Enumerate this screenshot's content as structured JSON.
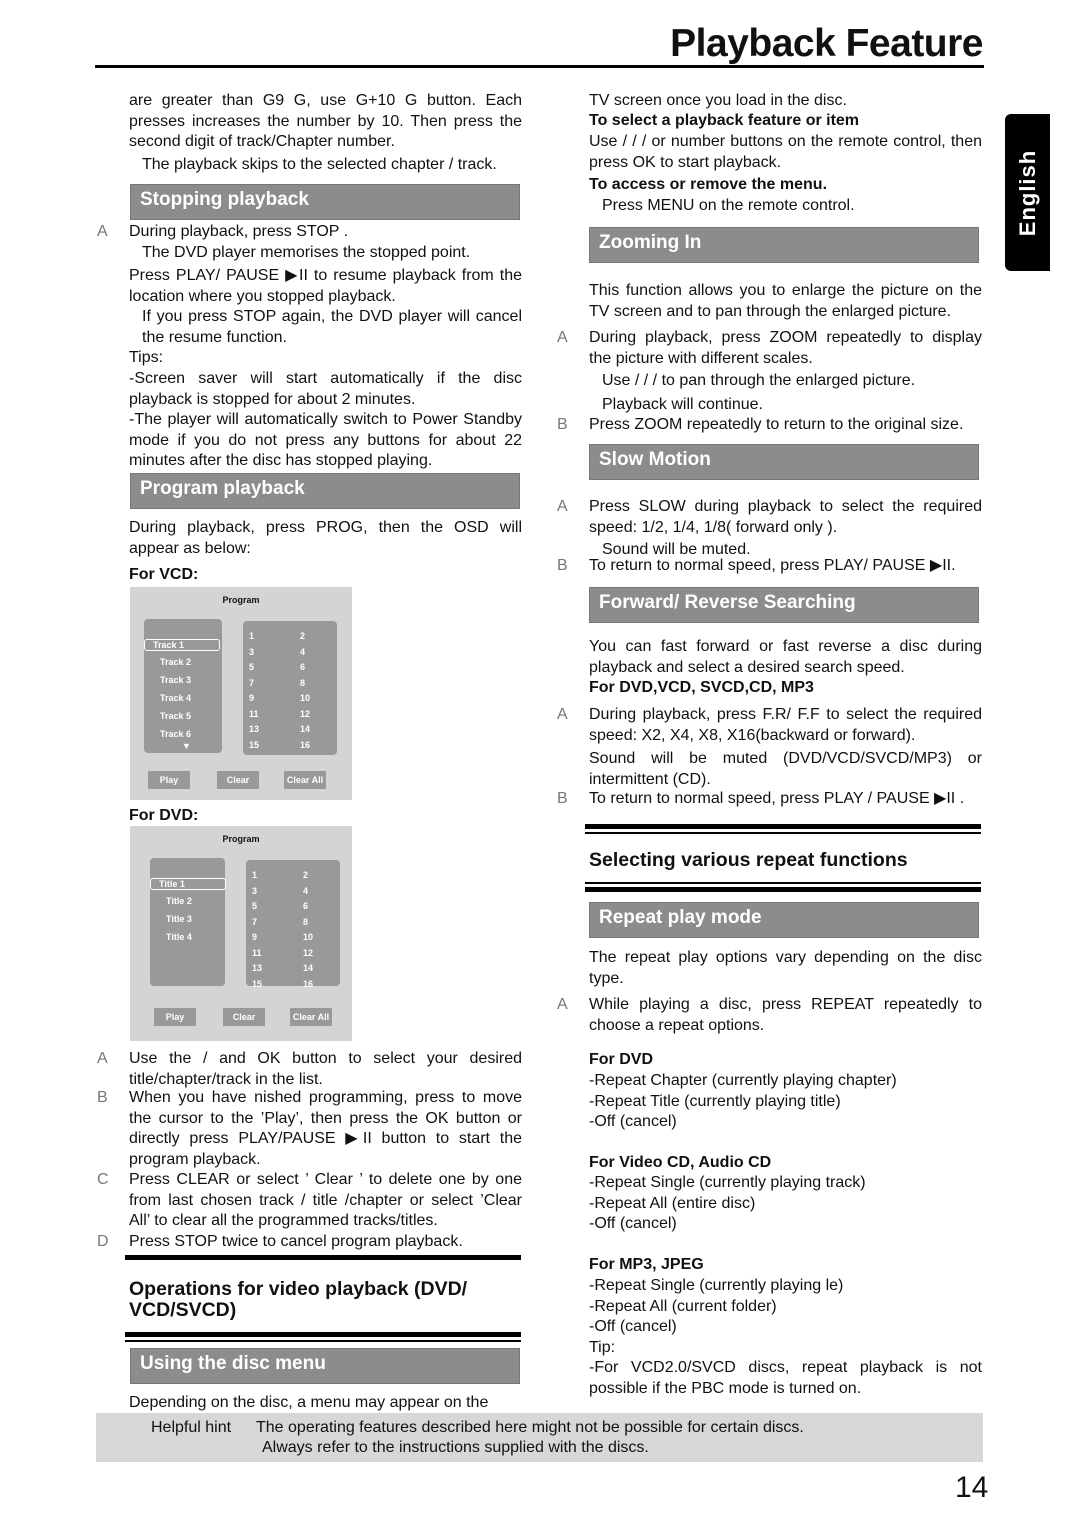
{
  "page_title": "Playback Feature",
  "language_tab": "English",
  "page_number": "14",
  "footer": {
    "label": "Helpful hint",
    "line1": "The operating features described here might not be possible for certain discs.",
    "line2": "Always refer to the instructions  supplied with the discs."
  },
  "left": [
    {
      "type": "p",
      "text": "are greater than  G9 G, use  G+10 G button. Each presses increases the number by 10. Then press the second digit of track/Chapter number."
    },
    {
      "type": "pi",
      "text": "The playback skips to the selected chapter / track."
    },
    {
      "type": "header",
      "text": "Stopping playback"
    },
    {
      "type": "step",
      "letter": "A",
      "text": "During playback, press STOP    ."
    },
    {
      "type": "pi",
      "text": "The DVD player memorises the stopped point."
    },
    {
      "type": "p",
      "text": "Press PLAY/ PAUSE ▶II to resume playback from the location where you stopped playback."
    },
    {
      "type": "pi",
      "text": "If you press STOP      again, the DVD player will cancel the resume function."
    },
    {
      "type": "p",
      "text": "Tips:"
    },
    {
      "type": "p",
      "text": "-Screen saver will start automatically if the disc playback is stopped for about 2 minutes."
    },
    {
      "type": "p",
      "text": "-The player will automatically switch to Power Standby mode if you do not press any buttons for about 22 minutes after the disc has stopped playing."
    },
    {
      "type": "header",
      "text": "Program playback"
    },
    {
      "type": "p",
      "text": "During playback, press  PROG, then the OSD will appear as below:"
    },
    {
      "type": "bold",
      "text": "For VCD:"
    },
    {
      "type": "osd",
      "title": "Program",
      "items": [
        "Track 1",
        "Track 2",
        "Track 3",
        "Track 4",
        "Track 5",
        "Track 6"
      ],
      "selected": 0,
      "more_arrow": "▼",
      "numbers": [
        "1",
        "2",
        "3",
        "4",
        "5",
        "6",
        "7",
        "8",
        "9",
        "10",
        "11",
        "12",
        "13",
        "14",
        "15",
        "16"
      ],
      "buttons": [
        "Play",
        "Clear",
        "Clear All"
      ]
    },
    {
      "type": "bold",
      "text": "For DVD:"
    },
    {
      "type": "osd",
      "title": "Program",
      "items": [
        "Title 1",
        "Title 2",
        "Title 3",
        "Title 4"
      ],
      "selected": 0,
      "numbers": [
        "1",
        "2",
        "3",
        "4",
        "5",
        "6",
        "7",
        "8",
        "9",
        "10",
        "11",
        "12",
        "13",
        "14",
        "15",
        "16"
      ],
      "buttons": [
        "Play",
        "Clear",
        "Clear All"
      ]
    },
    {
      "type": "step",
      "letter": "A",
      "text": "Use the    /     and OK button to select your desired title/chapter/track in the list."
    },
    {
      "type": "step",
      "letter": "B",
      "text": "When you have  nished programming, press      to move the cursor to the ’Play’, then press the OK button or directly press PLAY/PAUSE ▶II button to start the program playback."
    },
    {
      "type": "step",
      "letter": "C",
      "text": "Press CLEAR or select ’ Clear ’ to delete one by one from last chosen track / title /chapter or select ’Clear All’ to clear all the programmed tracks/titles."
    },
    {
      "type": "step",
      "letter": "D",
      "text": "Press STOP twice to cancel program playback."
    },
    {
      "type": "rule"
    },
    {
      "type": "heading",
      "text": "Operations for video playback (DVD/ VCD/SVCD)"
    },
    {
      "type": "rule2"
    },
    {
      "type": "header",
      "text": "Using the disc menu"
    },
    {
      "type": "p",
      "text": "Depending on the disc, a menu may appear on the"
    }
  ],
  "right": [
    {
      "type": "p",
      "text": "TV screen once you load in the disc."
    },
    {
      "type": "bold",
      "text": "To select a playback feature or item"
    },
    {
      "type": "p",
      "text": "   Use    /   /   /    or number buttons on the remote control, then press OK to start playback."
    },
    {
      "type": "bold",
      "text": "To access or remove the menu."
    },
    {
      "type": "pi",
      "text": "Press MENU on the remote control."
    },
    {
      "type": "header",
      "text": "Zooming In"
    },
    {
      "type": "p",
      "text": "This function allows you to enlarge the picture on the TV screen and to pan through the enlarged picture."
    },
    {
      "type": "step",
      "letter": "A",
      "text": "During playback, press ZOOM repeatedly to display the picture with different scales."
    },
    {
      "type": "pi",
      "text": "Use    /   /   /    to pan through the enlarged picture."
    },
    {
      "type": "pi",
      "text": "Playback will continue."
    },
    {
      "type": "step",
      "letter": "B",
      "text": "Press ZOOM repeatedly to return to the original size."
    },
    {
      "type": "header",
      "text": "Slow Motion"
    },
    {
      "type": "step",
      "letter": "A",
      "text": "Press SLOW during playback to select the required speed: 1/2, 1/4, 1/8( forward only )."
    },
    {
      "type": "pi",
      "text": "Sound will be muted."
    },
    {
      "type": "step",
      "letter": "B",
      "text": "To return to normal speed, press PLAY/ PAUSE ▶II."
    },
    {
      "type": "header",
      "text": "Forward/ Reverse Searching"
    },
    {
      "type": "p",
      "text": "You can fast forward or fast reverse a disc during playback and select a desired search speed."
    },
    {
      "type": "bold",
      "text": "For  DVD,VCD, SVCD,CD, MP3"
    },
    {
      "type": "step",
      "letter": "A",
      "text": "During playback, press F.R/ F.F to select the required speed: X2, X4, X8, X16(backward or forward)."
    },
    {
      "type": "p",
      "text": "     Sound will be muted (DVD/VCD/SVCD/MP3) or intermittent (CD)."
    },
    {
      "type": "step",
      "letter": "B",
      "text": "To return to normal speed, press PLAY / PAUSE ▶II ."
    },
    {
      "type": "rule2"
    },
    {
      "type": "heading",
      "text": "Selecting various repeat functions"
    },
    {
      "type": "rule3"
    },
    {
      "type": "header",
      "text": "Repeat play mode"
    },
    {
      "type": "p",
      "text": "The repeat play options vary depending on the disc type."
    },
    {
      "type": "step",
      "letter": "A",
      "text": "While playing a disc, press REPEAT repeatedly to choose a repeat options."
    },
    {
      "type": "bold",
      "text": "For DVD"
    },
    {
      "type": "pl",
      "text": "-Repeat Chapter (currently playing chapter)\n-Repeat Title (currently playing title)\n-Off (cancel)"
    },
    {
      "type": "bold",
      "text": "For Video CD, Audio CD"
    },
    {
      "type": "pl",
      "text": "-Repeat Single (currently playing track)\n-Repeat All (entire disc)\n-Off (cancel)"
    },
    {
      "type": "bold",
      "text": "For MP3, JPEG"
    },
    {
      "type": "pl",
      "text": "-Repeat Single (currently playing  le)\n-Repeat All (current folder)\n-Off (cancel)\nTip:"
    },
    {
      "type": "p",
      "text": "-For VCD2.0/SVCD discs, repeat playback is not possible if the PBC mode is turned on."
    }
  ]
}
